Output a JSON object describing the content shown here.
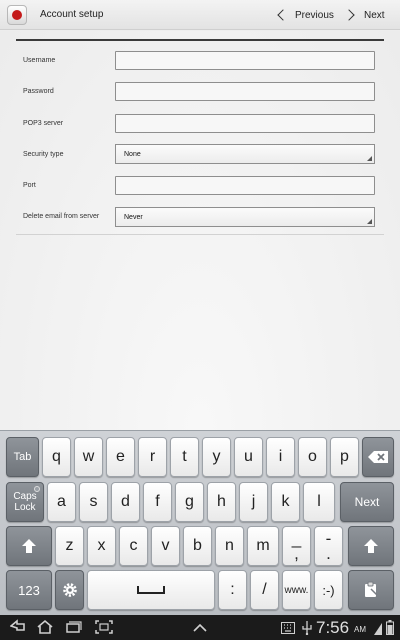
{
  "action_bar": {
    "title": "Account setup",
    "previous_label": "Previous",
    "next_label": "Next"
  },
  "form": {
    "username_label": "Username",
    "username_value": "",
    "password_label": "Password",
    "password_value": "",
    "server_label": "POP3 server",
    "server_value": "",
    "security_label": "Security type",
    "security_value": "None",
    "port_label": "Port",
    "port_value": "",
    "delete_label": "Delete email from server",
    "delete_value": "Never"
  },
  "keyboard": {
    "tab": "Tab",
    "row1": [
      "q",
      "w",
      "e",
      "r",
      "t",
      "y",
      "u",
      "i",
      "o",
      "p"
    ],
    "caps_top": "Caps",
    "caps_bottom": "Lock",
    "row2": [
      "a",
      "s",
      "d",
      "f",
      "g",
      "h",
      "j",
      "k",
      "l"
    ],
    "next": "Next",
    "row3": [
      "z",
      "x",
      "c",
      "v",
      "b",
      "n",
      "m"
    ],
    "underscore_top": "_",
    "underscore_bottom": ",",
    "dash_top": "-",
    "dash_bottom": ".",
    "numeric": "123",
    "colon": ":",
    "slash": "/",
    "www": "www.",
    "smiley": ":-)"
  },
  "status_bar": {
    "time": "7:56",
    "ampm": "AM"
  },
  "colors": {
    "accent_red": "#c41a1a",
    "key_dark": "#7d8288",
    "system_bar": "#1b1b1b"
  }
}
